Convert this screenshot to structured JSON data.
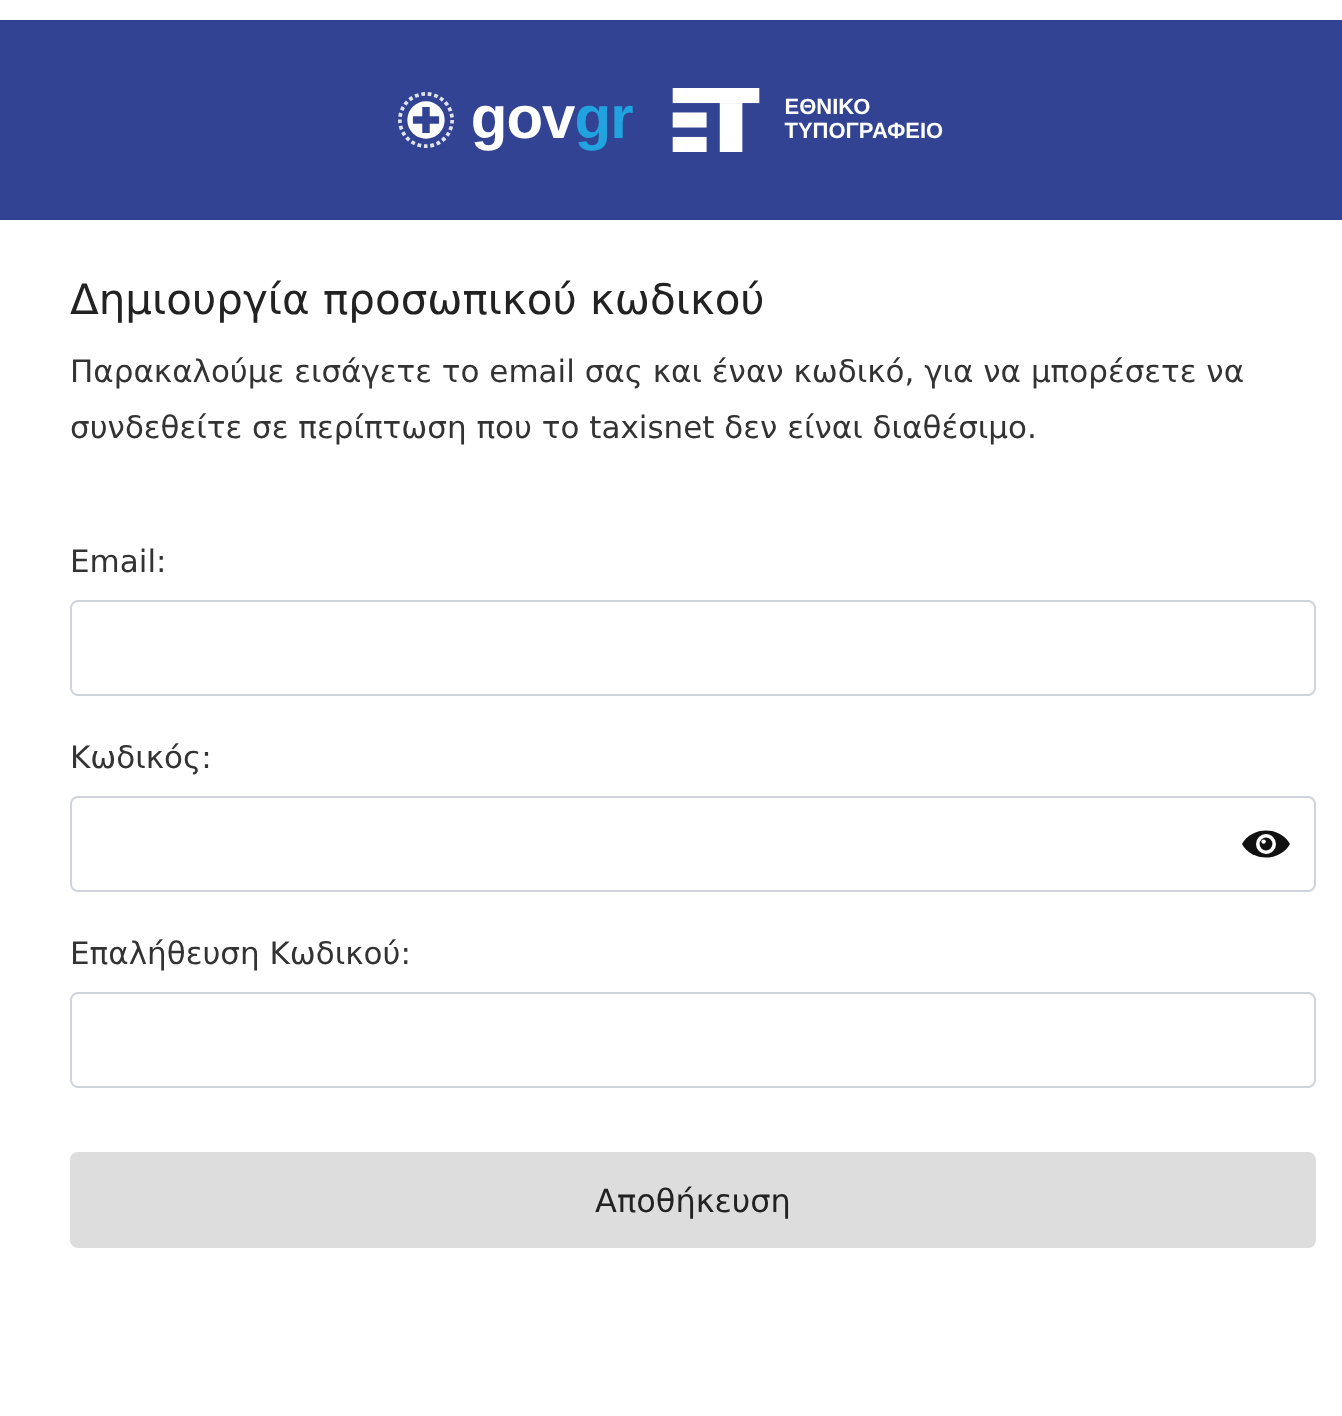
{
  "header": {
    "logo_parts": [
      {
        "text": "gov",
        "kind": "plain"
      },
      {
        "text": "gr",
        "kind": "accent"
      }
    ],
    "publisher_lines": [
      "ΕΘΝΙΚΟ",
      "ΤΥΠΟΓΡΑΦΕΙΟ"
    ]
  },
  "title": "Δημιουργία προσωπικού κωδικού",
  "intro": "Παρακαλούμε εισάγετε το email σας και έναν κωδικό, για να μπορέσετε να συνδεθείτε σε περίπτωση που το taxisnet δεν είναι διαθέσιμο.",
  "fields": [
    {
      "label": "Email:",
      "kind": "text"
    },
    {
      "label": "Κωδικός:",
      "kind": "password"
    },
    {
      "label": "Επαλήθευση Κωδικού:",
      "kind": "plain"
    }
  ],
  "submit": "Αποθήκευση"
}
